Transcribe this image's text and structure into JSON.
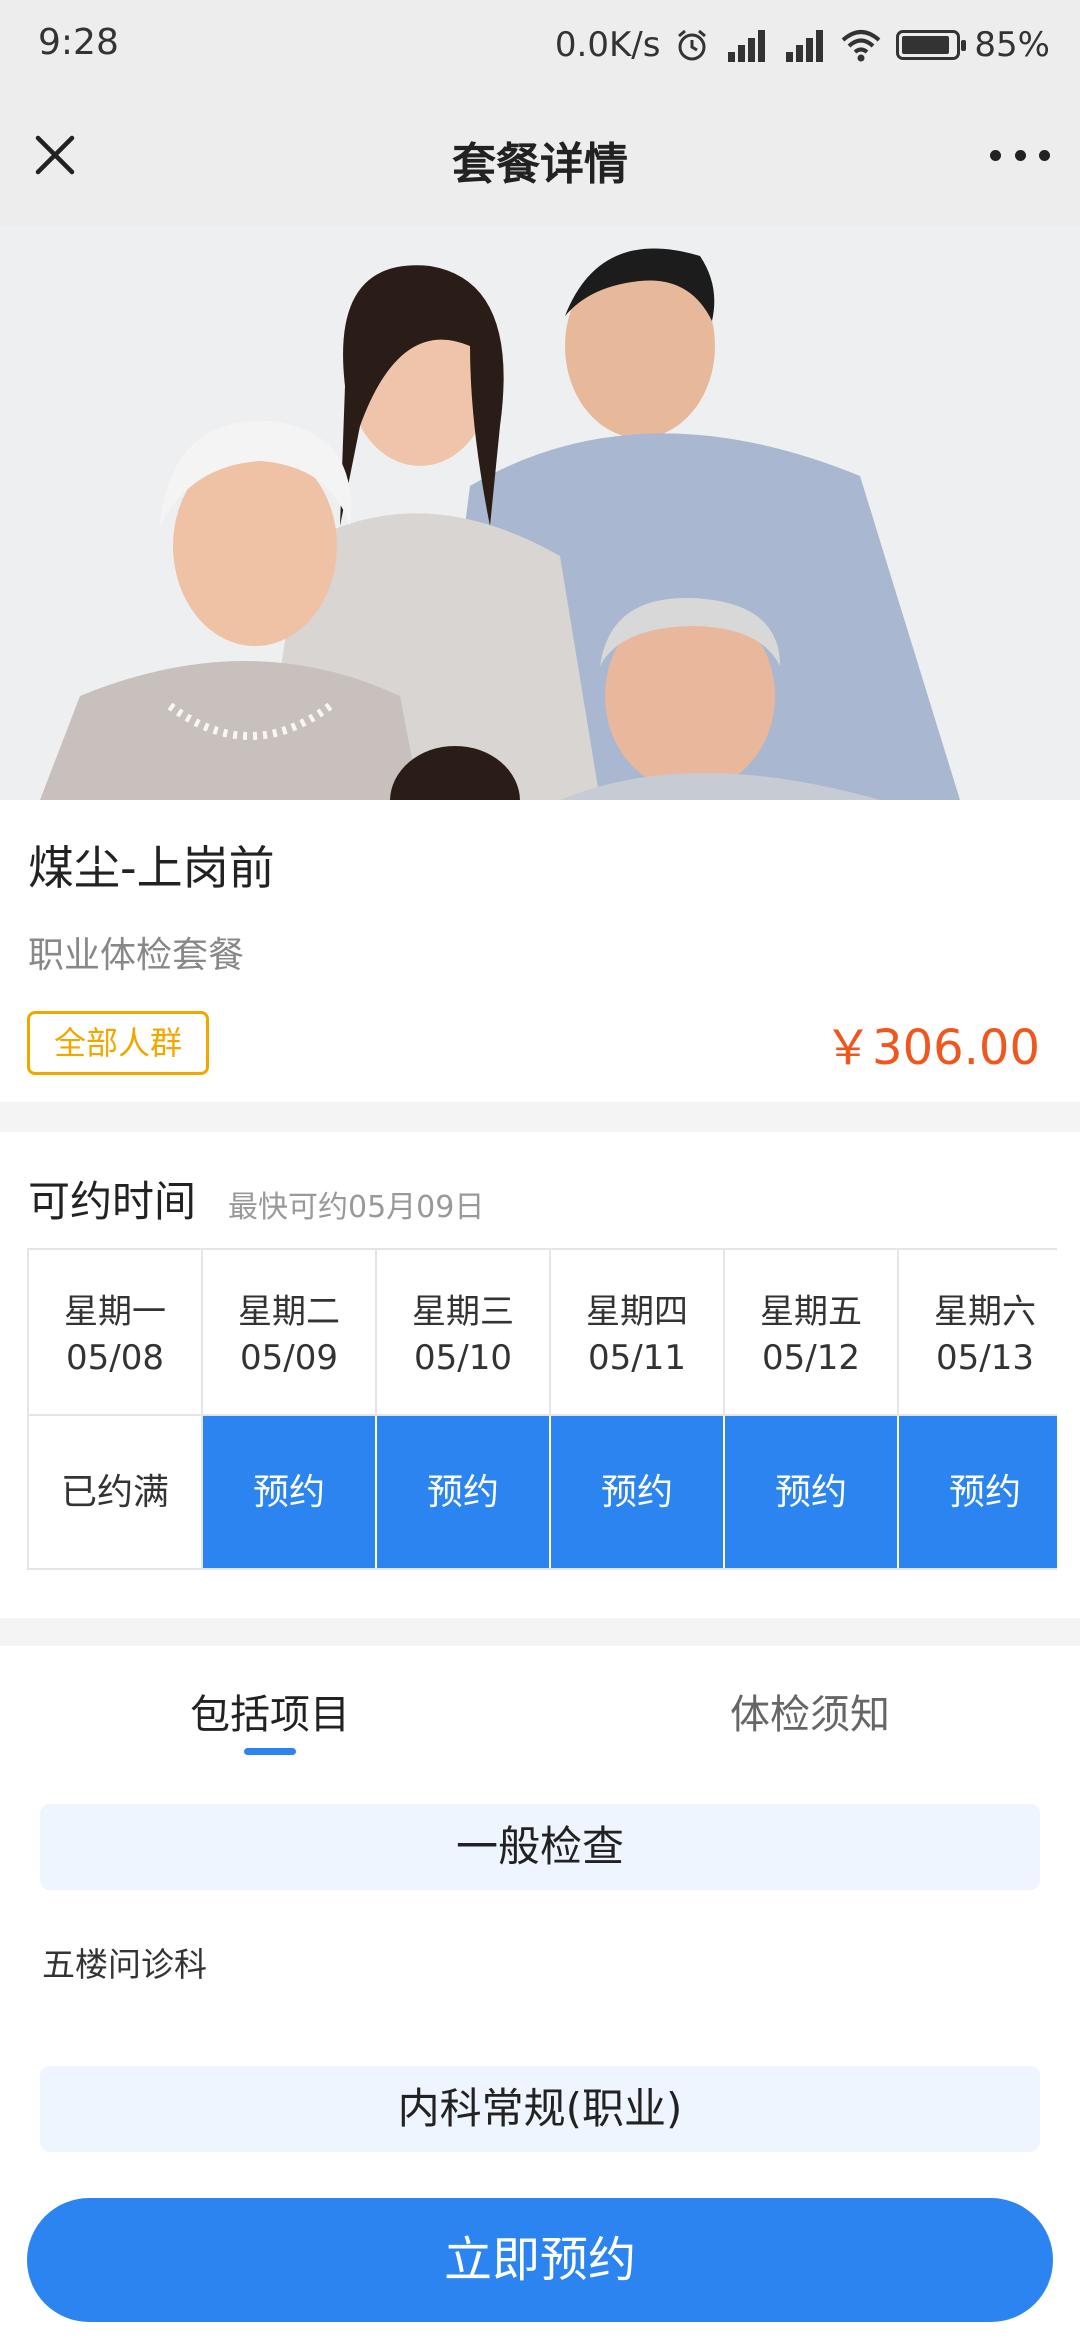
{
  "status_bar": {
    "time": "9:28",
    "net_speed": "0.0K/s",
    "battery": "85%",
    "icons": [
      "alarm-icon",
      "signal-hd-icon",
      "signal-hd-icon",
      "wifi-icon",
      "battery-icon"
    ]
  },
  "nav": {
    "title": "套餐详情",
    "close_icon": "close-icon",
    "more_icon": "more-icon"
  },
  "package": {
    "name": "煤尘-上岗前",
    "subtitle": "职业体检套餐",
    "tag": "全部人群",
    "price": "￥306.00"
  },
  "schedule": {
    "title": "可约时间",
    "earliest": "最快可约05月09日",
    "days": [
      {
        "weekday": "星期一",
        "date": "05/08",
        "status": "已约满",
        "available": false
      },
      {
        "weekday": "星期二",
        "date": "05/09",
        "status": "预约",
        "available": true
      },
      {
        "weekday": "星期三",
        "date": "05/10",
        "status": "预约",
        "available": true
      },
      {
        "weekday": "星期四",
        "date": "05/11",
        "status": "预约",
        "available": true
      },
      {
        "weekday": "星期五",
        "date": "05/12",
        "status": "预约",
        "available": true
      },
      {
        "weekday": "星期六",
        "date": "05/13",
        "status": "预约",
        "available": true
      }
    ]
  },
  "tabs": [
    {
      "label": "包括项目",
      "active": true
    },
    {
      "label": "体检须知",
      "active": false
    }
  ],
  "items": {
    "category1": "一般检查",
    "category1_items": [
      "五楼问诊科"
    ],
    "category2": "内科常规(职业)"
  },
  "book_button": "立即预约",
  "colors": {
    "accent": "#2b84f0",
    "price": "#f0571e",
    "tag": "#f0a800"
  }
}
